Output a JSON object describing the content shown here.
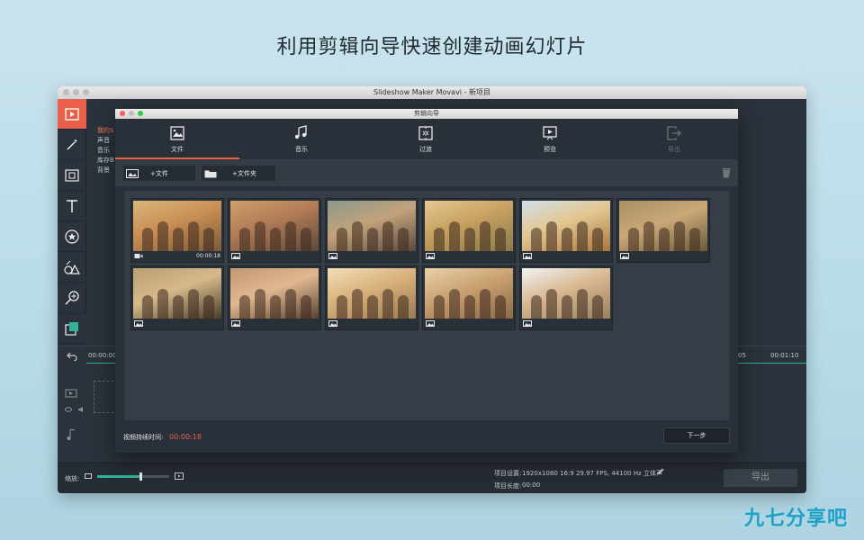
{
  "headline": "利用剪辑向导快速创建动画幻灯片",
  "main_window": {
    "title": "Slideshow Maker Movavi - 新项目",
    "side_list": [
      "我的S",
      "声音",
      "音乐",
      "库存B",
      "背景"
    ],
    "ruler": {
      "left": "00:00:00",
      "mid": "05",
      "right": "00:01:10"
    },
    "bottom": {
      "zoom_label": "缩放:",
      "zoom_level": 0.6,
      "project_settings_label": "项目设置:",
      "project_settings_value": "1920x1080 16:9 29.97 FPS, 44100 Hz 立体声",
      "project_length_label": "项目长度:",
      "project_length_value": "00:00",
      "export_label": "导出"
    }
  },
  "wizard": {
    "title": "剪辑向导",
    "tabs": [
      {
        "label": "文件",
        "icon": "image-file-icon",
        "active": true,
        "disabled": false
      },
      {
        "label": "音乐",
        "icon": "music-note-icon",
        "active": false,
        "disabled": false
      },
      {
        "label": "过渡",
        "icon": "transition-icon",
        "active": false,
        "disabled": false
      },
      {
        "label": "预览",
        "icon": "preview-icon",
        "active": false,
        "disabled": false
      },
      {
        "label": "导出",
        "icon": "export-icon",
        "active": false,
        "disabled": true
      }
    ],
    "add_files_label": "+文件",
    "add_folder_label": "+文件夹",
    "items": [
      {
        "type": "video",
        "duration": "00:00:18"
      },
      {
        "type": "image",
        "duration": ""
      },
      {
        "type": "image",
        "duration": ""
      },
      {
        "type": "image",
        "duration": ""
      },
      {
        "type": "image",
        "duration": ""
      },
      {
        "type": "image",
        "duration": ""
      },
      {
        "type": "image",
        "duration": ""
      },
      {
        "type": "image",
        "duration": ""
      },
      {
        "type": "image",
        "duration": ""
      },
      {
        "type": "image",
        "duration": ""
      },
      {
        "type": "image",
        "duration": ""
      }
    ],
    "duration_label": "视频持续时间:",
    "duration_value": "00:00:18",
    "next_label": "下一步"
  },
  "watermark": "九七分享吧",
  "colors": {
    "accent": "#e8604a",
    "timeline": "#2fb39a",
    "watermark": "#1fa2c6"
  }
}
